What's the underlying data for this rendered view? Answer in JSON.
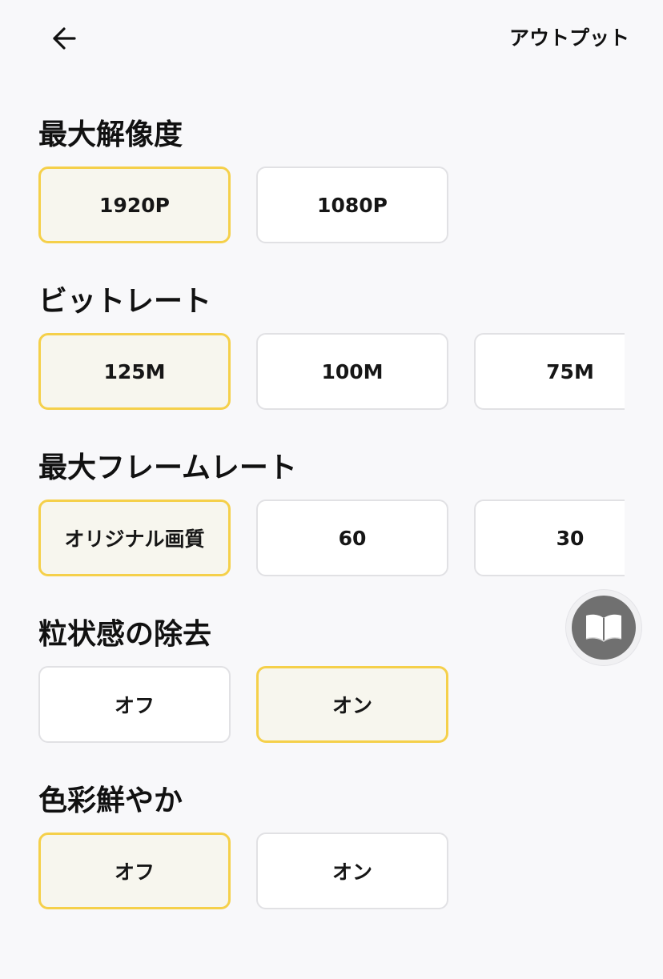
{
  "header": {
    "back_icon": "arrow-left-icon",
    "output_label": "アウトプット"
  },
  "sections": [
    {
      "title": "最大解像度",
      "options": [
        {
          "label": "1920P",
          "selected": true
        },
        {
          "label": "1080P",
          "selected": false
        }
      ]
    },
    {
      "title": "ビットレート",
      "options": [
        {
          "label": "125M",
          "selected": true
        },
        {
          "label": "100M",
          "selected": false
        },
        {
          "label": "75M",
          "selected": false
        }
      ]
    },
    {
      "title": "最大フレームレート",
      "options": [
        {
          "label": "オリジナル画質",
          "selected": true
        },
        {
          "label": "60",
          "selected": false
        },
        {
          "label": "30",
          "selected": false
        }
      ]
    },
    {
      "title": "粒状感の除去",
      "options": [
        {
          "label": "オフ",
          "selected": false
        },
        {
          "label": "オン",
          "selected": true
        }
      ]
    },
    {
      "title": "色彩鮮やか",
      "options": [
        {
          "label": "オフ",
          "selected": true
        },
        {
          "label": "オン",
          "selected": false
        }
      ]
    }
  ],
  "floating_button": {
    "icon": "book-icon"
  },
  "colors": {
    "background": "#f8f8fa",
    "selected_border": "#f5d04a",
    "selected_fill": "#f7f6ee",
    "option_border": "#e1e1e4",
    "floating_icon_bg": "#707070"
  }
}
